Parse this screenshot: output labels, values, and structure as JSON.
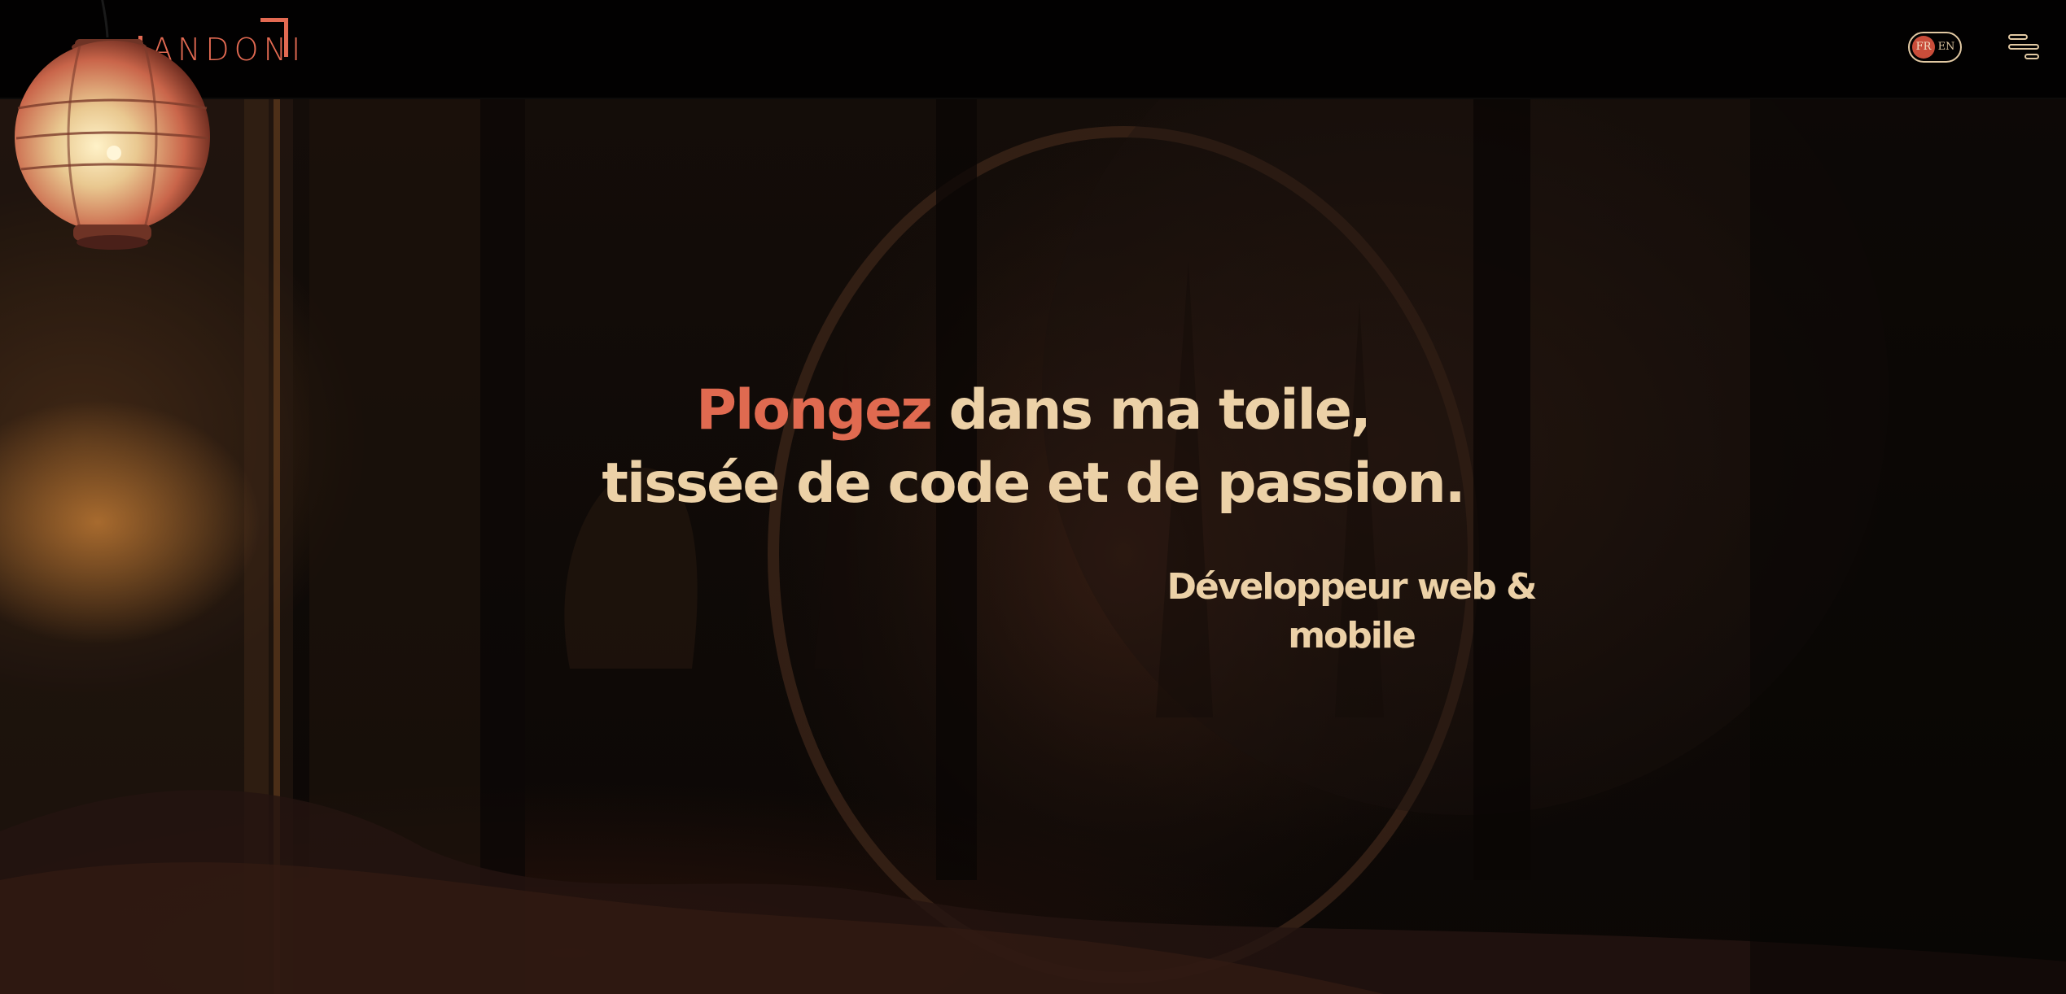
{
  "header": {
    "logo_text": "ANDONI",
    "languages": [
      {
        "code": "FR",
        "active": true
      },
      {
        "code": "EN",
        "active": false
      }
    ],
    "menu_icon": "hamburger-menu-icon"
  },
  "hero": {
    "headline_accent": "Plongez",
    "headline_line1_rest": " dans ma toile,",
    "headline_line2": "tissée de code et de passion.",
    "subtitle": "Développeur web & mobile"
  },
  "colors": {
    "accent": "#e06a50",
    "text": "#ecd1a7",
    "header_bg": "#020101",
    "lang_active_bg": "#c94d3a"
  }
}
